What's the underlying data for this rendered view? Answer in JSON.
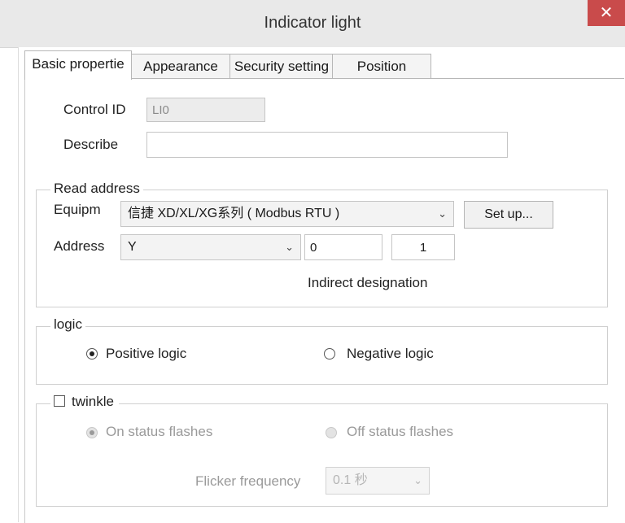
{
  "window": {
    "title": "Indicator light",
    "close_glyph": "✕"
  },
  "tabs": [
    "Basic propertie",
    "Appearance",
    "Security setting",
    "Position"
  ],
  "basic": {
    "control_id_label": "Control ID",
    "control_id_value": "LI0",
    "describe_label": "Describe",
    "describe_value": ""
  },
  "read_address": {
    "title": "Read address",
    "equipment_label": "Equipm",
    "equipment_value": "信捷 XD/XL/XG系列 ( Modbus RTU )",
    "setup_button": "Set up...",
    "address_label": "Address",
    "address_type": "Y",
    "address_value": "0",
    "address_count": "1",
    "indirect_label": "Indirect designation"
  },
  "logic": {
    "title": "logic",
    "positive_label": "Positive logic",
    "negative_label": "Negative logic",
    "selected": "positive"
  },
  "twinkle": {
    "label": "twinkle",
    "checked": false,
    "on_status_label": "On status flashes",
    "off_status_label": "Off status flashes",
    "frequency_label": "Flicker frequency",
    "frequency_value": "0.1 秒"
  }
}
